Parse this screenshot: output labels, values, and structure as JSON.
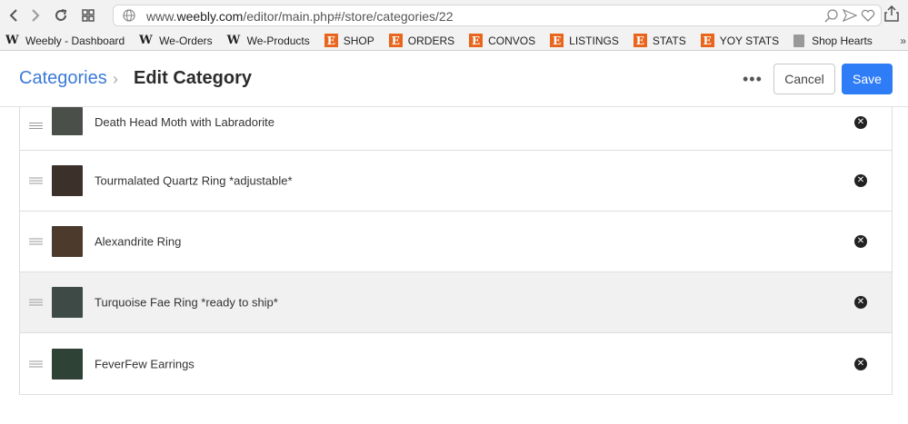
{
  "browser": {
    "url_prefix": "www.",
    "url_domain": "weebly.com",
    "url_path": "/editor/main.php#/store/categories/22",
    "back_icon": "chevron-left-icon",
    "forward_icon": "chevron-right-icon",
    "reload_icon": "reload-icon",
    "tabs_icon": "grid-icon"
  },
  "bookmarks": [
    {
      "label": "Weebly - Dashboard",
      "icon": "weebly-icon"
    },
    {
      "label": "We-Orders",
      "icon": "weebly-icon"
    },
    {
      "label": "We-Products",
      "icon": "weebly-icon"
    },
    {
      "label": "SHOP",
      "icon": "etsy-icon"
    },
    {
      "label": "ORDERS",
      "icon": "etsy-icon"
    },
    {
      "label": "CONVOS",
      "icon": "etsy-icon"
    },
    {
      "label": "LISTINGS",
      "icon": "etsy-icon"
    },
    {
      "label": "STATS",
      "icon": "etsy-icon"
    },
    {
      "label": "YOY STATS",
      "icon": "etsy-icon"
    },
    {
      "label": "Shop Hearts",
      "icon": "page-icon"
    }
  ],
  "header": {
    "breadcrumb_link": "Categories",
    "separator": "›",
    "title": "Edit Category",
    "more": "•••",
    "cancel_label": "Cancel",
    "save_label": "Save"
  },
  "products": [
    {
      "name": "Death Head Moth with Labradorite",
      "thumb_color": "#4a4f4a",
      "highlighted": false
    },
    {
      "name": "Tourmalated Quartz Ring *adjustable*",
      "thumb_color": "#3b302a",
      "highlighted": false
    },
    {
      "name": "Alexandrite Ring",
      "thumb_color": "#4c3a2c",
      "highlighted": false
    },
    {
      "name": "Turquoise Fae Ring *ready to ship*",
      "thumb_color": "#3d4a46",
      "highlighted": true
    },
    {
      "name": "FeverFew Earrings",
      "thumb_color": "#2f4236",
      "highlighted": false
    }
  ],
  "colors": {
    "accent": "#2f7df6",
    "link": "#3b7ad9",
    "etsy": "#e8651d"
  }
}
